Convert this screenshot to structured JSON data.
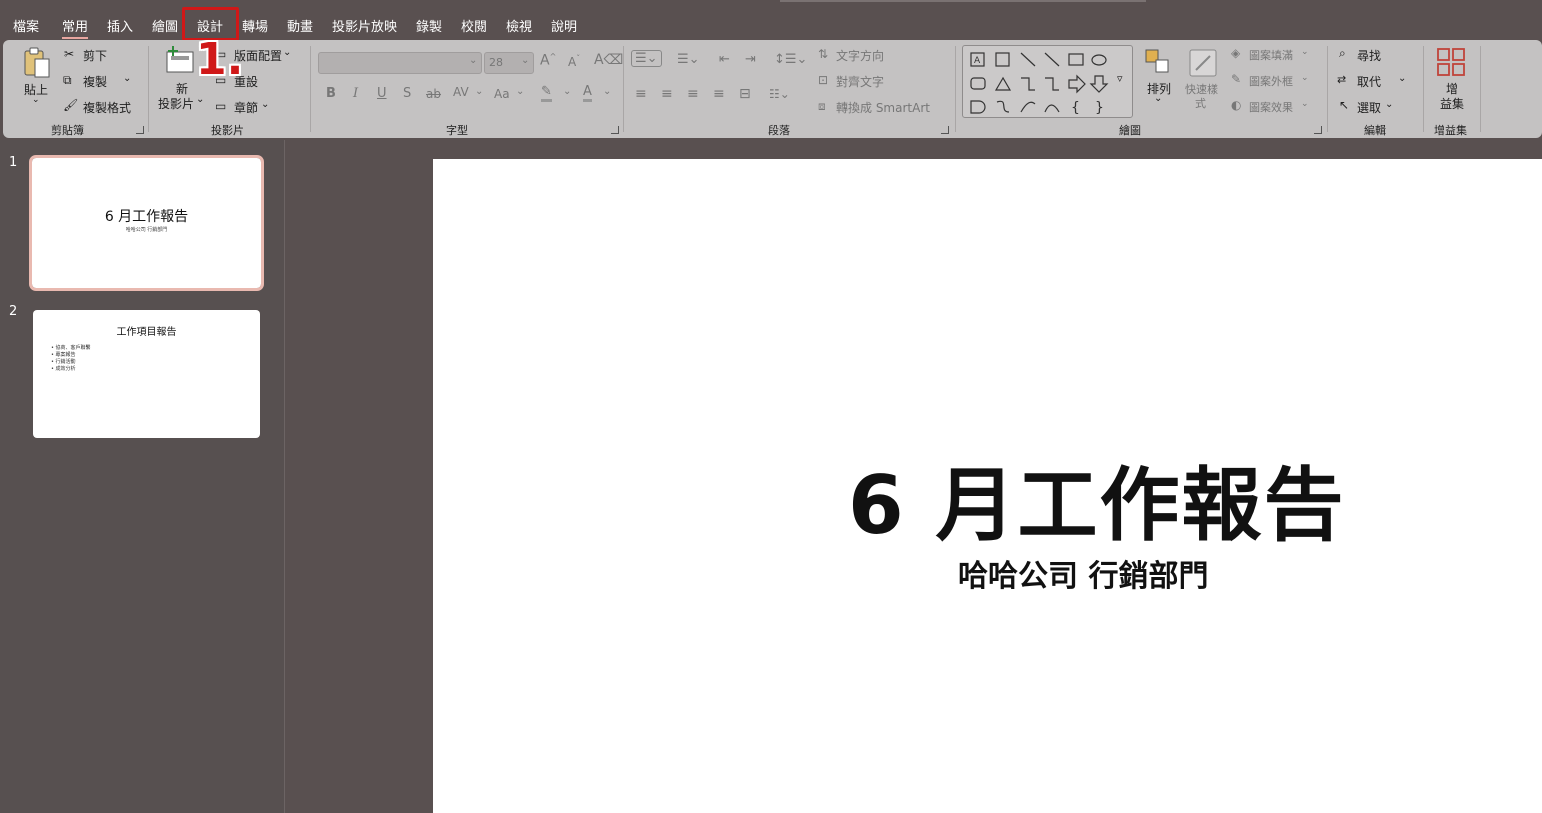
{
  "menu": {
    "items": [
      "檔案",
      "常用",
      "插入",
      "繪圖",
      "設計",
      "轉場",
      "動畫",
      "投影片放映",
      "錄製",
      "校閱",
      "檢視",
      "說明"
    ],
    "active": "常用",
    "highlighted": "設計"
  },
  "annotation": {
    "step": "1."
  },
  "ribbon": {
    "clipboard": {
      "paste": "貼上",
      "cut": "剪下",
      "copy": "複製",
      "format_painter": "複製格式",
      "label": "剪貼簿"
    },
    "slides": {
      "new_slide_line1": "新",
      "new_slide_line2": "投影片",
      "layout": "版面配置",
      "reset": "重設",
      "section": "章節",
      "label": "投影片"
    },
    "font": {
      "font_name": "",
      "font_size": "28",
      "bold": "B",
      "italic": "I",
      "underline": "U",
      "strike": "S",
      "strike2": "ab",
      "spacing": "AV",
      "case": "Aa",
      "label": "字型"
    },
    "paragraph": {
      "text_direction": "文字方向",
      "align_text": "對齊文字",
      "smartart": "轉換成 SmartArt",
      "label": "段落"
    },
    "drawing": {
      "arrange": "排列",
      "quick_styles_line1": "快速樣",
      "quick_styles_line2": "式",
      "shape_fill": "圖案填滿",
      "shape_outline": "圖案外框",
      "shape_effects": "圖案效果",
      "label": "繪圖"
    },
    "editing": {
      "find": "尋找",
      "replace": "取代",
      "select": "選取",
      "label": "編輯"
    },
    "addins": {
      "line1": "增",
      "line2": "益集",
      "label": "增益集"
    }
  },
  "slides": [
    {
      "number": "1",
      "title": "6 月工作報告",
      "subtitle": "哈哈公司 行銷部門"
    },
    {
      "number": "2",
      "title": "工作項目報告",
      "bullets": [
        "• 協商、客戶聯繫",
        "• 專案報告",
        "• 行銷活動",
        "• 成效分析"
      ]
    }
  ],
  "current_slide": {
    "title": "6 月工作報告",
    "subtitle": "哈哈公司 行銷部門"
  },
  "colors": {
    "accent": "#d01818",
    "background": "#595050",
    "ribbon": "#c4c2c2",
    "selection": "#e9b9b0"
  }
}
